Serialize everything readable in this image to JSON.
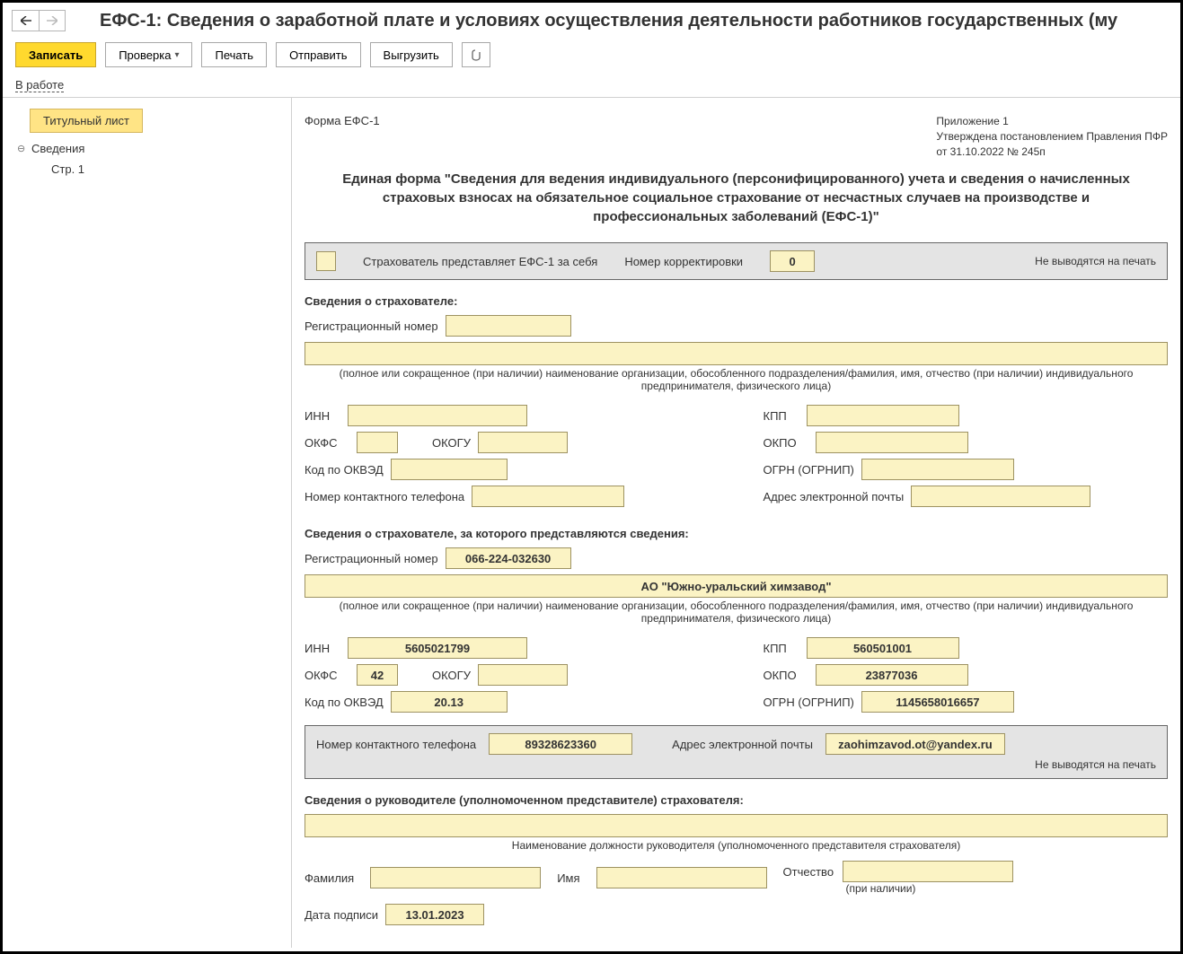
{
  "title": "ЕФС-1: Сведения о заработной плате и условиях осуществления деятельности работников государственных (му",
  "toolbar": {
    "save": "Записать",
    "check": "Проверка",
    "print": "Печать",
    "send": "Отправить",
    "export": "Выгрузить"
  },
  "status": {
    "label": "В работе"
  },
  "sidebar": {
    "title_tab": "Титульный лист",
    "info": "Сведения",
    "page1": "Стр. 1"
  },
  "hdr": {
    "form_code": "Форма ЕФС-1",
    "appendix": "Приложение 1",
    "approved": "Утверждена постановлением Правления ПФР",
    "dated": "от 31.10.2022 № 245п"
  },
  "form_title": "Единая форма \"Сведения для ведения индивидуального (персонифицированного) учета и сведения о начисленных страховых взносах на обязательное социальное страхование от несчастных случаев на производстве и профессиональных заболеваний (ЕФС-1)\"",
  "top_panel": {
    "self_text": "Страхователь представляет ЕФС-1 за себя",
    "corr_label": "Номер корректировки",
    "corr_val": "0",
    "noprint": "Не выводятся на печать"
  },
  "sec1": {
    "heading": "Сведения о страхователе:",
    "reg_lbl": "Регистрационный номер",
    "reg_val": "",
    "name_val": "",
    "name_hint": "(полное или сокращенное (при наличии) наименование организации, обособленного подразделения/фамилия, имя, отчество (при наличии) индивидуального предпринимателя, физического лица)",
    "inn_lbl": "ИНН",
    "inn_val": "",
    "kpp_lbl": "КПП",
    "kpp_val": "",
    "okfs_lbl": "ОКФС",
    "okfs_val": "",
    "okogu_lbl": "ОКОГУ",
    "okogu_val": "",
    "okpo_lbl": "ОКПО",
    "okpo_val": "",
    "okved_lbl": "Код по ОКВЭД",
    "okved_val": "",
    "ogrn_lbl": "ОГРН (ОГРНИП)",
    "ogrn_val": "",
    "phone_lbl": "Номер контактного телефона",
    "phone_val": "",
    "email_lbl": "Адрес электронной почты",
    "email_val": ""
  },
  "sec2": {
    "heading": "Сведения о страхователе, за которого представляются сведения:",
    "reg_lbl": "Регистрационный номер",
    "reg_val": "066-224-032630",
    "name_val": "АО \"Южно-уральский химзавод\"",
    "name_hint": "(полное или сокращенное (при наличии) наименование организации, обособленного подразделения/фамилия, имя, отчество (при наличии) индивидуального предпринимателя, физического лица)",
    "inn_lbl": "ИНН",
    "inn_val": "5605021799",
    "kpp_lbl": "КПП",
    "kpp_val": "560501001",
    "okfs_lbl": "ОКФС",
    "okfs_val": "42",
    "okogu_lbl": "ОКОГУ",
    "okogu_val": "",
    "okpo_lbl": "ОКПО",
    "okpo_val": "23877036",
    "okved_lbl": "Код по ОКВЭД",
    "okved_val": "20.13",
    "ogrn_lbl": "ОГРН (ОГРНИП)",
    "ogrn_val": "1145658016657",
    "phone_lbl": "Номер контактного телефона",
    "phone_val": "89328623360",
    "email_lbl": "Адрес электронной почты",
    "email_val": "zaohimzavod.ot@yandex.ru",
    "noprint": "Не выводятся на печать"
  },
  "sec3": {
    "heading": "Сведения о руководителе (уполномоченном представителе) страхователя:",
    "pos_val": "",
    "pos_hint": "Наименование должности руководителя (уполномоченного представителя страхователя)",
    "fam_lbl": "Фамилия",
    "fam_val": "",
    "name_lbl": "Имя",
    "name_val": "",
    "patr_lbl": "Отчество",
    "patr_val": "",
    "patr_hint": "(при наличии)",
    "date_lbl": "Дата подписи",
    "date_val": "13.01.2023"
  }
}
